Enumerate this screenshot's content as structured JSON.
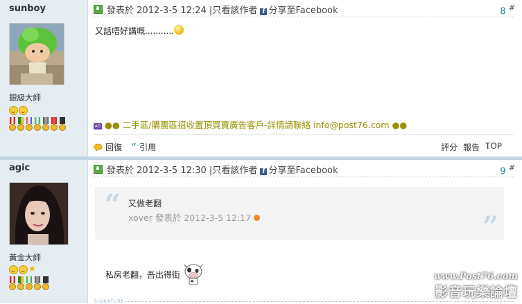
{
  "posts": [
    {
      "username": "sunboy",
      "rank": "銀級大師",
      "posted_label": "發表於",
      "posted_time": "2012-3-5 12:24",
      "separator": "|",
      "only_author": "只看該作者",
      "share_facebook": "分享至Facebook",
      "floor": "8",
      "floor_suffix": "#",
      "message": "又話唔好講嘅...........",
      "ad_bullets": "●●",
      "ad_text": "二手區/購團區招收置頂買賣廣告客戶-詳情請聯絡 info@post76.com",
      "ad_icon_text": "AD",
      "actions": {
        "reply": "回復",
        "quote": "引用",
        "rate": "評分",
        "report": "報告",
        "top": "TOP"
      }
    },
    {
      "username": "agic",
      "rank": "黃金大師",
      "posted_label": "發表於",
      "posted_time": "2012-3-5 12:30",
      "separator": "|",
      "only_author": "只看該作者",
      "share_facebook": "分享至Facebook",
      "floor": "9",
      "floor_suffix": "#",
      "quote_text": "又做老翻",
      "quote_meta": "xover 發表於 2012-3-5 12:17",
      "message": "私房老翻，吾出得街"
    }
  ],
  "signature_label": "SIGNATURE",
  "watermark": {
    "site": "www.Post76.com",
    "name": "影音玩樂論壇"
  },
  "colors": {
    "sidebar": "#e5edf2",
    "ad_text": "#9b8f00",
    "floor": "#2a7fb5",
    "quote_meta": "#999999"
  }
}
